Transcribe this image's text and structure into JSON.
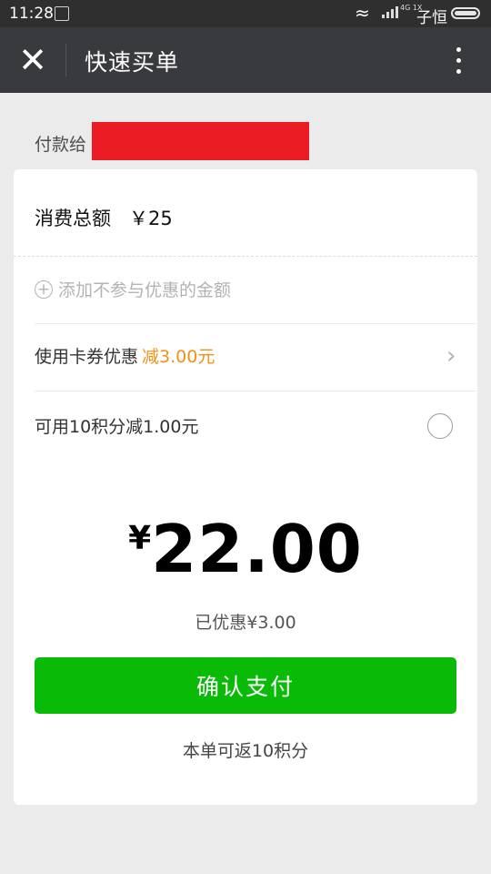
{
  "status": {
    "time": "11:28",
    "network": "4G 1X",
    "carrier": "子恒"
  },
  "header": {
    "title": "快速买单",
    "close_icon": "close-icon",
    "more_icon": "more-vertical-icon"
  },
  "payee": {
    "label": "付款给"
  },
  "total": {
    "label": "消费总额",
    "amount": "￥25"
  },
  "add_excluded": {
    "label": "添加不参与优惠的金额"
  },
  "coupon": {
    "label": "使用卡券优惠",
    "discount": "减3.00元"
  },
  "points": {
    "label": "可用10积分减1.00元",
    "selected": false
  },
  "payment": {
    "currency": "¥",
    "amount": "22.00",
    "saved": "已优惠¥3.00"
  },
  "confirm": {
    "label": "确认支付"
  },
  "rebate": {
    "text": "本单可返10积分"
  },
  "colors": {
    "accent_green": "#09bb07",
    "discount_orange": "#f29014",
    "redaction_red": "#ec1c24",
    "header_bg": "#393a3e"
  }
}
